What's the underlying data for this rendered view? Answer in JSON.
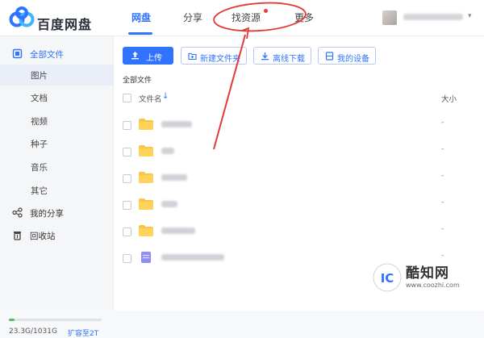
{
  "app": {
    "name": "百度网盘",
    "brand_color": "#2f73ff",
    "logo_icon": "cloud-logo-icon"
  },
  "nav": {
    "tabs": [
      {
        "label": "网盘",
        "active": true
      },
      {
        "label": "分享",
        "active": false
      },
      {
        "label": "找资源",
        "active": false,
        "badge": "red-dot"
      },
      {
        "label": "更多",
        "active": false
      }
    ]
  },
  "user": {
    "avatar_icon": "avatar",
    "name_blurred": true
  },
  "sidebar": {
    "items": [
      {
        "label": "全部文件",
        "icon": "files-icon",
        "active": true
      },
      {
        "label": "图片",
        "sub": true
      },
      {
        "label": "文档",
        "sub": true
      },
      {
        "label": "视频",
        "sub": true
      },
      {
        "label": "种子",
        "sub": true
      },
      {
        "label": "音乐",
        "sub": true
      },
      {
        "label": "其它",
        "sub": true
      },
      {
        "label": "我的分享",
        "icon": "share-icon"
      },
      {
        "label": "回收站",
        "icon": "trash-icon"
      }
    ],
    "storage": {
      "used_text": "23.3G/1031G",
      "used_fraction": 0.023,
      "expand_label": "扩容至2T",
      "bar_color": "#4fc35a"
    }
  },
  "toolbar": {
    "upload_label": "上传",
    "new_folder_label": "新建文件夹",
    "offline_download_label": "离线下载",
    "my_devices_label": "我的设备"
  },
  "breadcrumb": "全部文件",
  "file_list": {
    "columns": {
      "name": "文件名",
      "size": "大小"
    },
    "rows": [
      {
        "type": "folder",
        "size": "-"
      },
      {
        "type": "folder",
        "size": "-"
      },
      {
        "type": "folder",
        "size": "-"
      },
      {
        "type": "folder",
        "size": "-"
      },
      {
        "type": "folder",
        "size": "-"
      },
      {
        "type": "file",
        "size": "-"
      }
    ]
  },
  "watermark": {
    "text": "酷知网",
    "url": "www.coozhi.com"
  },
  "annotation": {
    "color": "#e23a36",
    "target": "找资源"
  }
}
